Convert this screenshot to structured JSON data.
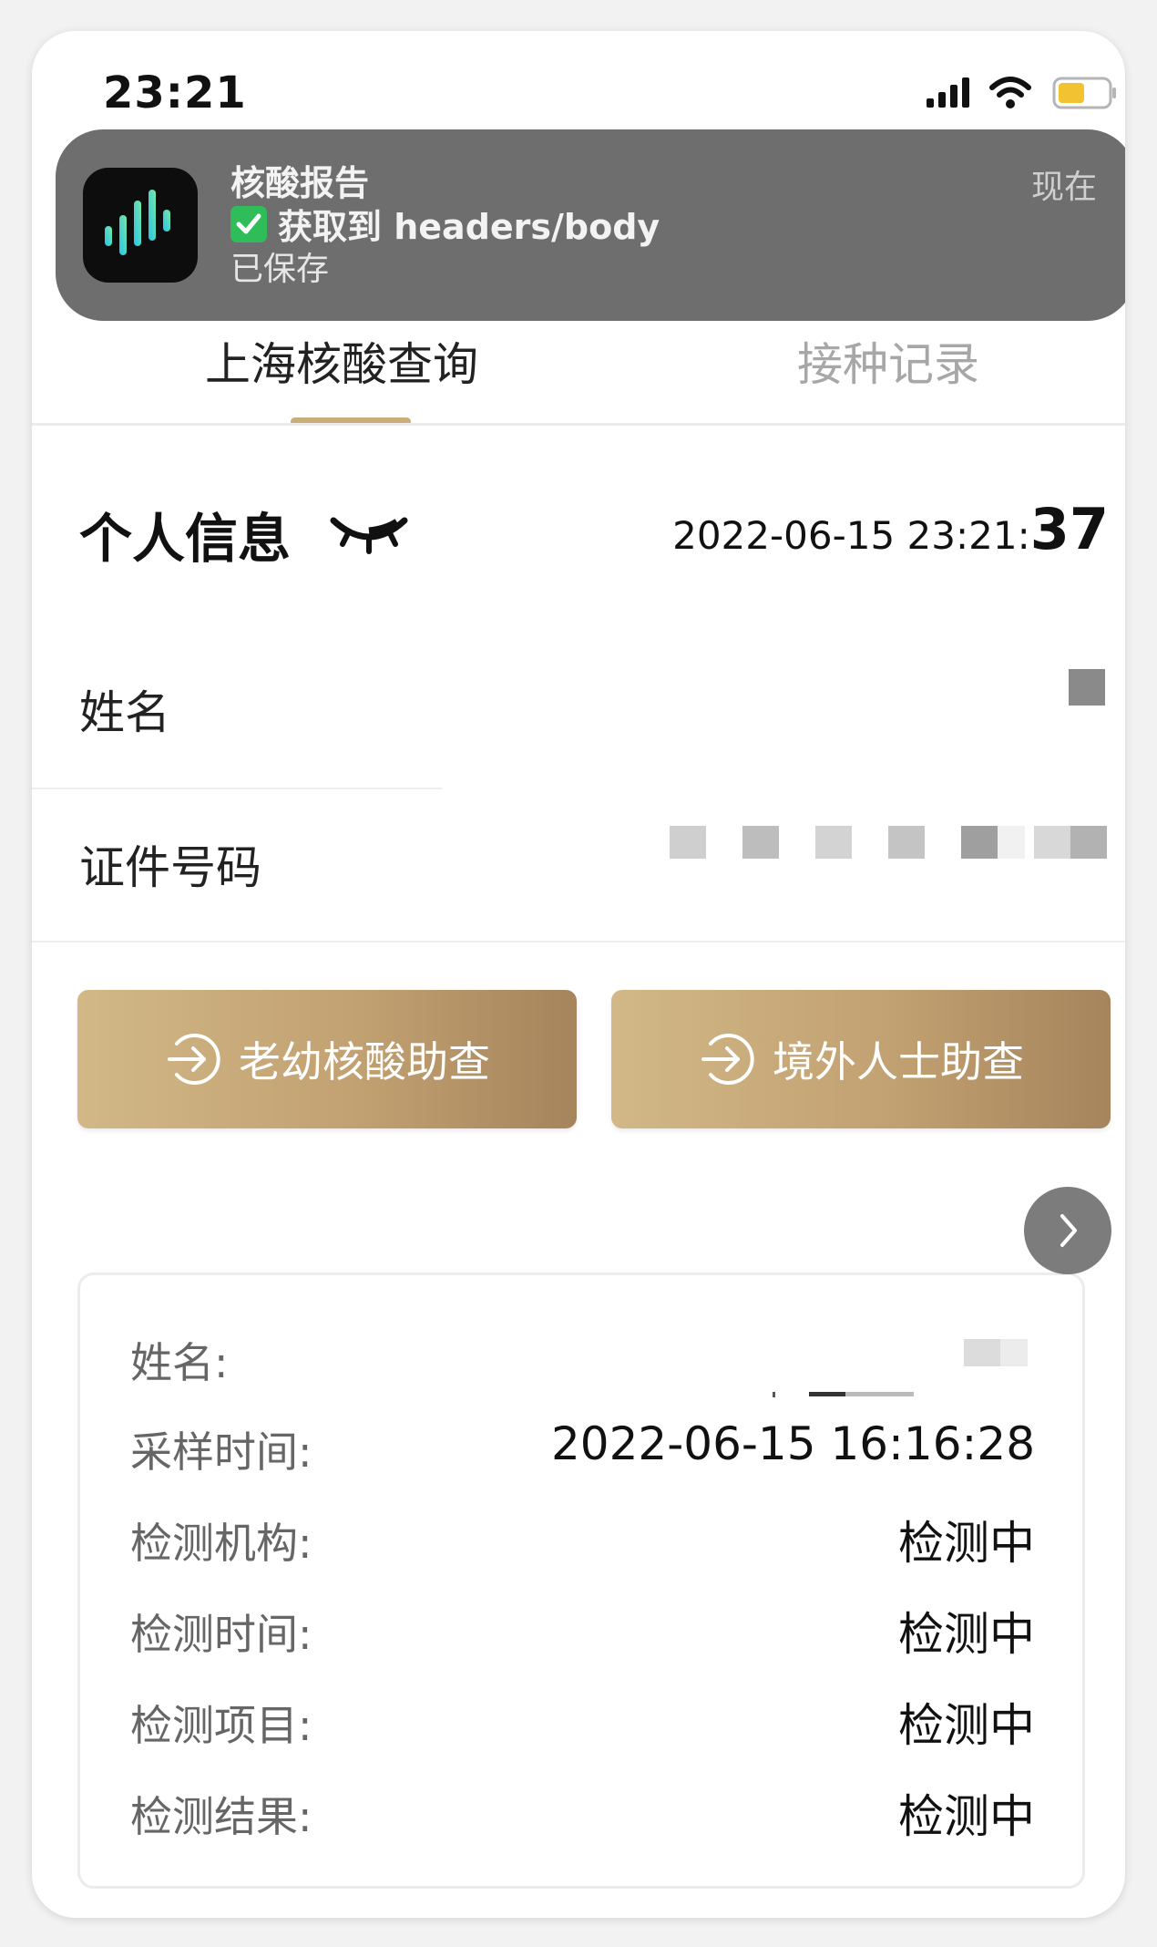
{
  "status_bar": {
    "time": "23:21"
  },
  "notification": {
    "app_name": "核酸报告",
    "line2": "获取到 headers/body",
    "line3": "已保存",
    "time": "现在"
  },
  "tabs": [
    {
      "label": "上海核酸查询"
    },
    {
      "label": "接种记录"
    }
  ],
  "personal_info": {
    "title": "个人信息",
    "timestamp_main": "2022-06-15 23:21:",
    "timestamp_seconds": "37",
    "name_label": "姓名",
    "id_label": "证件号码"
  },
  "buttons": {
    "elderly_child": "老幼核酸助查",
    "overseas": "境外人士助查"
  },
  "record": {
    "name_label": "姓名:",
    "sampling_time_label": "采样时间:",
    "sampling_time_value": "2022-06-15 16:16:28",
    "institution_label": "检测机构:",
    "institution_value": "检测中",
    "test_time_label": "检测时间:",
    "test_time_value": "检测中",
    "test_item_label": "检测项目:",
    "test_item_value": "检测中",
    "result_label": "检测结果:",
    "result_value": "检测中"
  },
  "icons": {
    "app": "waveform-app-icon",
    "check": "check-emoji-icon",
    "eye": "eye-closed-icon",
    "enter": "arrow-enter-icon",
    "next": "chevron-right-icon"
  },
  "colors": {
    "accent_gold": "#c9ae7a",
    "notification_bg": "#6e6e6e",
    "check_green": "#2ebd59",
    "battery_yellow": "#f2c230"
  }
}
